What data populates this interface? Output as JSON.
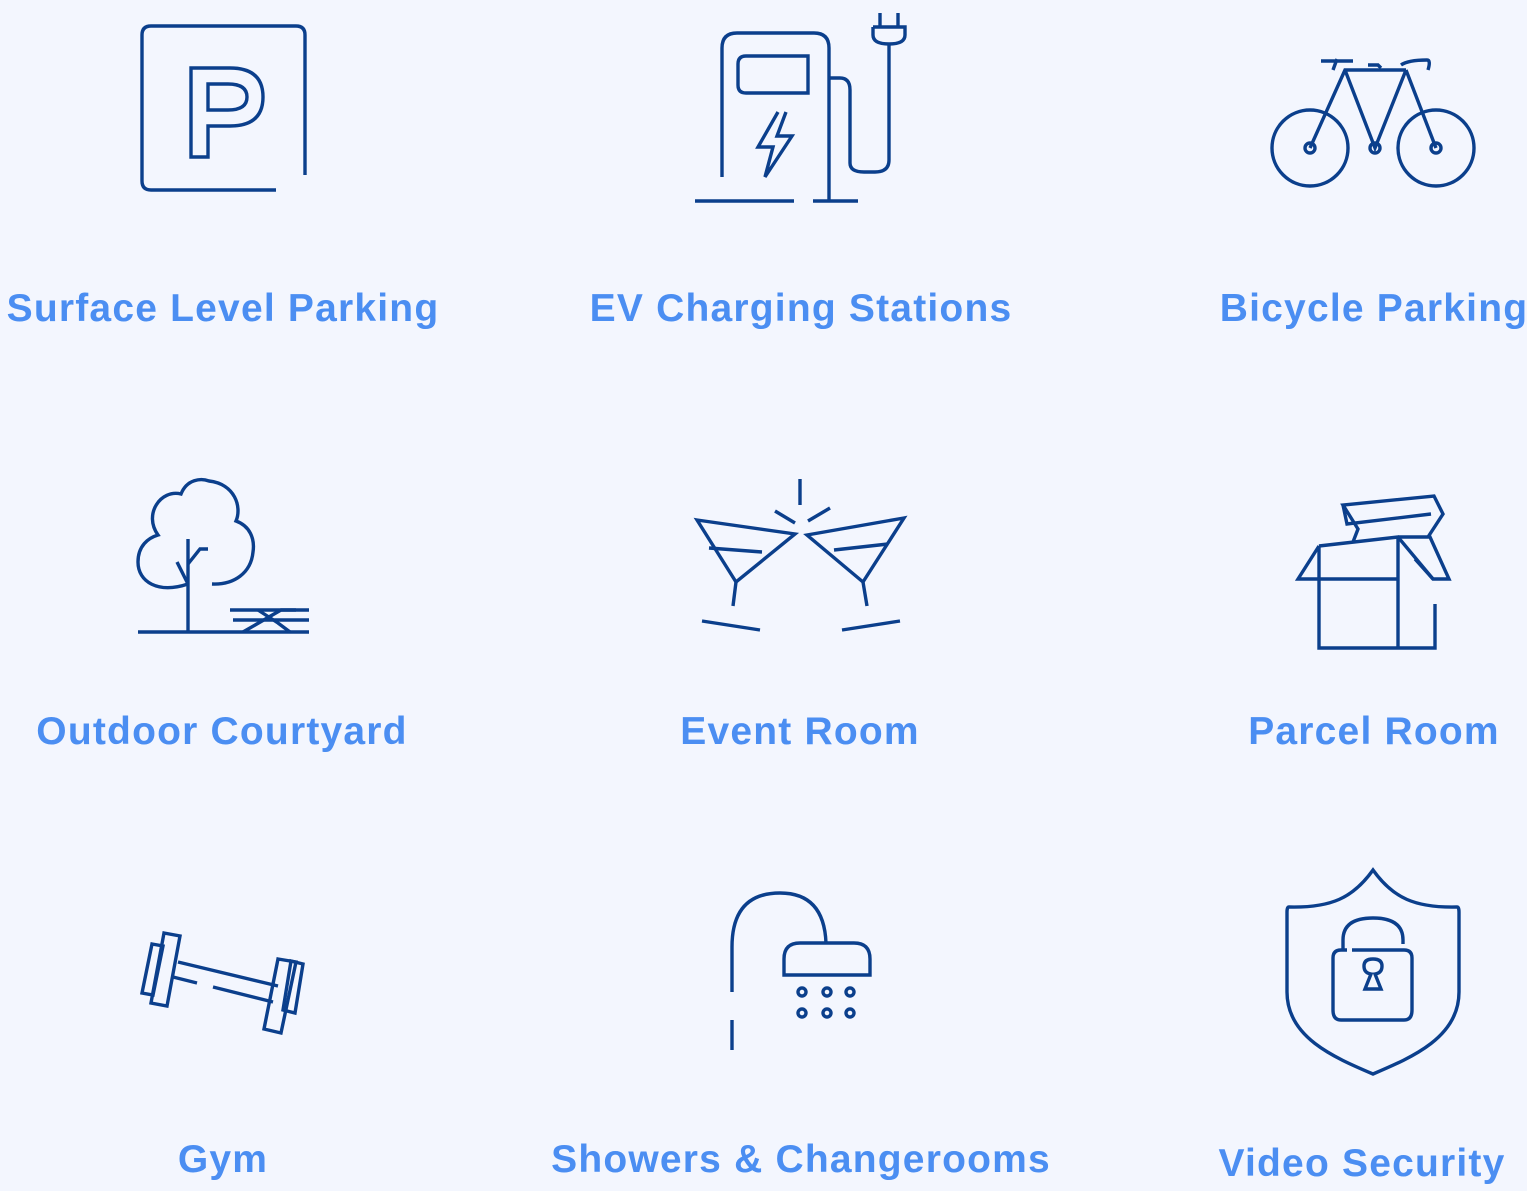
{
  "colors": {
    "background": "#f3f6fe",
    "icon_stroke": "#0b3f8c",
    "label_text": "#4b8ef2"
  },
  "amenities": [
    {
      "label": "Surface Level Parking",
      "icon": "parking-icon"
    },
    {
      "label": "EV Charging Stations",
      "icon": "ev-charger-icon"
    },
    {
      "label": "Bicycle Parking",
      "icon": "bicycle-icon"
    },
    {
      "label": "Outdoor Courtyard",
      "icon": "tree-picnic-table-icon"
    },
    {
      "label": "Event Room",
      "icon": "cocktail-glasses-icon"
    },
    {
      "label": "Parcel Room",
      "icon": "open-box-icon"
    },
    {
      "label": "Gym",
      "icon": "barbell-icon"
    },
    {
      "label": "Showers & Changerooms",
      "icon": "shower-icon"
    },
    {
      "label": "Video Security",
      "icon": "shield-lock-icon"
    }
  ]
}
